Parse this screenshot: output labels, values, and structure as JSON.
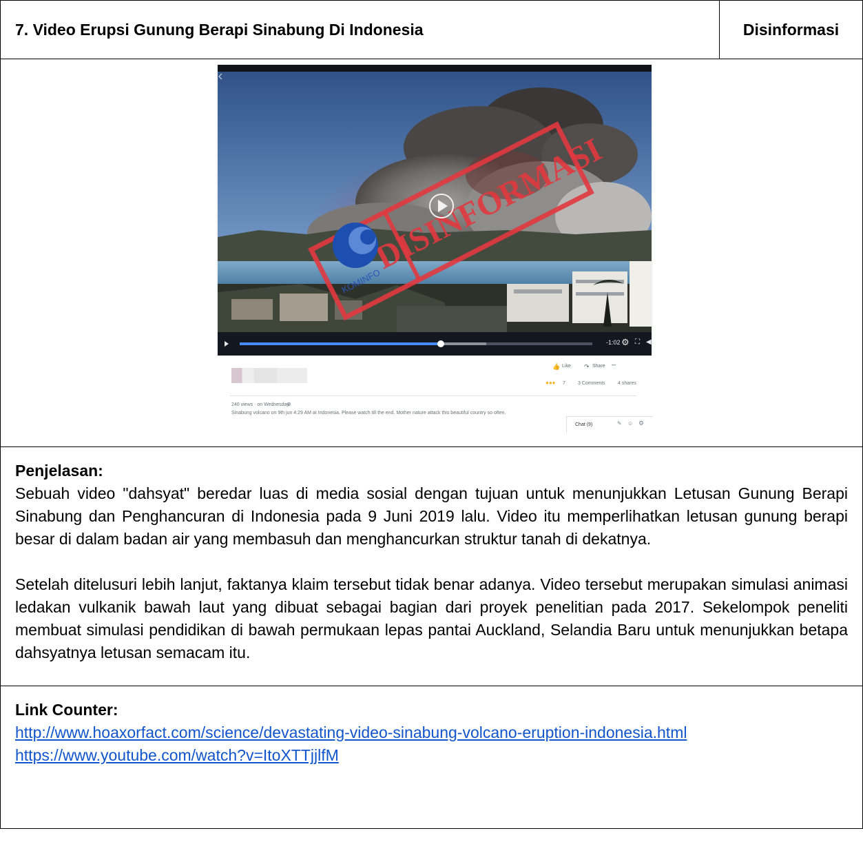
{
  "header": {
    "title": "7. Video Erupsi Gunung Berapi Sinabung Di Indonesia",
    "tag": "Disinformasi"
  },
  "screenshot": {
    "stamp_text": "DISINFORMASI",
    "logo_text": "KOMINFO",
    "player": {
      "time": "-1:02",
      "progress": 0.57,
      "buffered": 0.7
    },
    "post": {
      "like_label": "Like",
      "share_label": "Share",
      "more_label": "•••",
      "reaction_count": "7",
      "comments": "3 Comments",
      "shares": "4 shares",
      "meta": "240 views · on Wednesday",
      "caption": "Sinabung volcano on 9th jun 4:29 AM at Indonesia. Please watch till the end. Mother nature attack this beautiful country so often.",
      "chat_label": "Chat (9)"
    },
    "colors": {
      "stamp": "#e2393f",
      "progress": "#4a8cf7"
    }
  },
  "explanation": {
    "label": "Penjelasan:",
    "paragraph1": "Sebuah video \"dahsyat\" beredar luas di media sosial dengan tujuan untuk menunjukkan Letusan Gunung Berapi Sinabung dan Penghancuran di Indonesia pada 9 Juni 2019 lalu. Video itu memperlihatkan letusan gunung berapi besar di dalam badan air yang membasuh dan menghancurkan struktur tanah di dekatnya.",
    "paragraph2": "Setelah ditelusuri lebih lanjut, faktanya klaim tersebut tidak benar adanya. Video tersebut merupakan simulasi animasi ledakan vulkanik bawah laut yang dibuat sebagai bagian dari proyek penelitian pada 2017. Sekelompok peneliti membuat simulasi pendidikan di bawah permukaan lepas pantai Auckland, Selandia Baru untuk menunjukkan betapa dahsyatnya letusan semacam itu."
  },
  "links": {
    "label": "Link Counter:",
    "url1": "http://www.hoaxorfact.com/science/devastating-video-sinabung-volcano-eruption-indonesia.html",
    "url2": "https://www.youtube.com/watch?v=ItoXTTjjlfM"
  }
}
